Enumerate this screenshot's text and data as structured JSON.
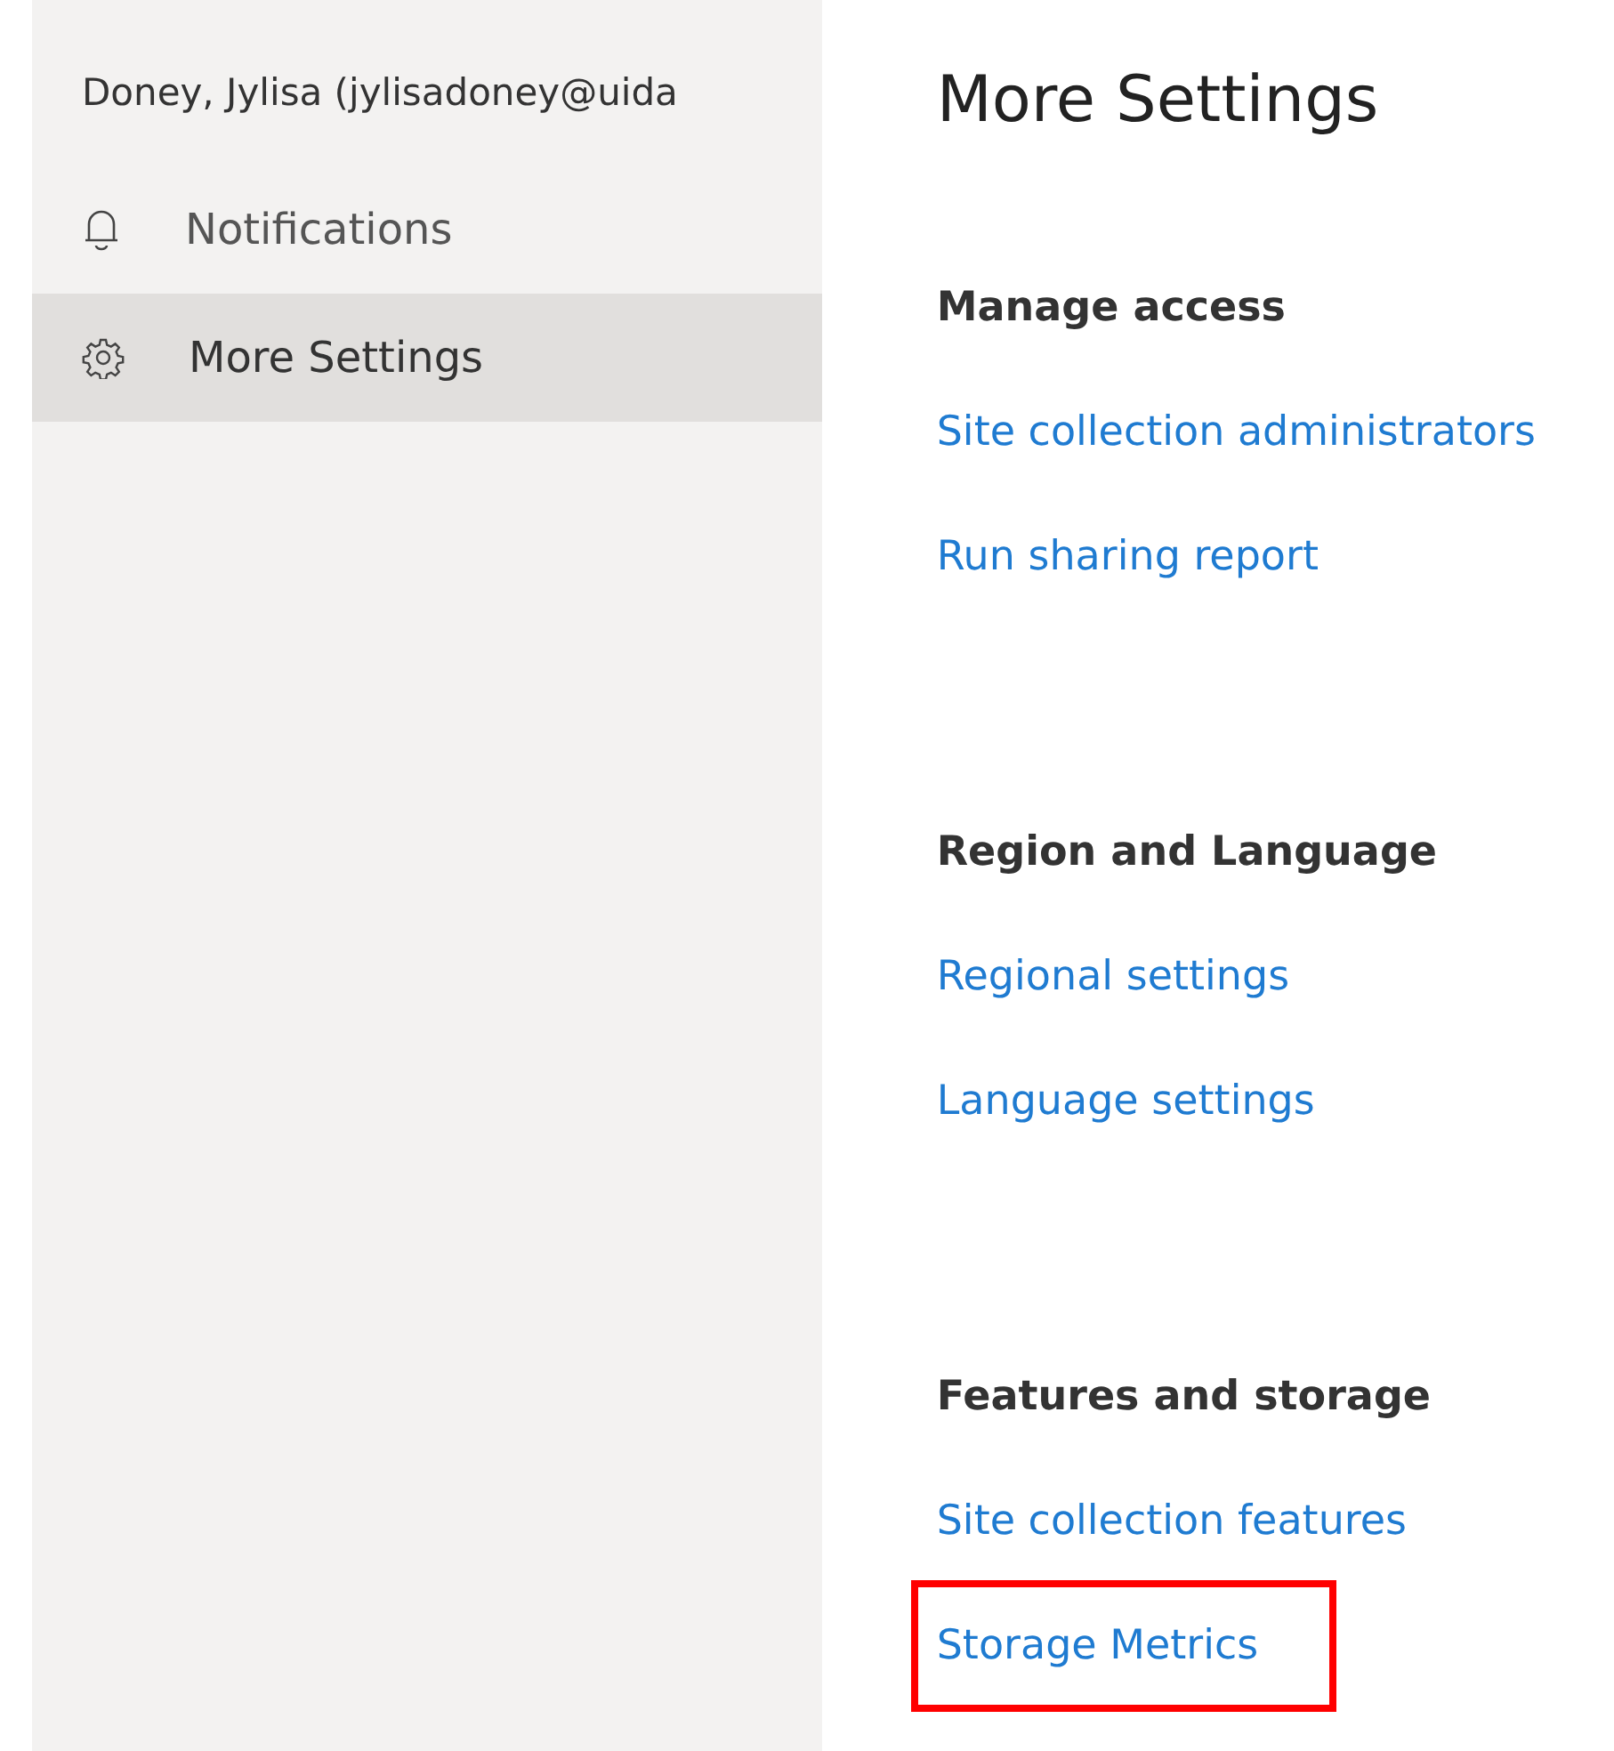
{
  "sidebar": {
    "account_name": "Doney, Jylisa (jylisadoney@uida",
    "items": [
      {
        "label": "Notifications",
        "kind": "bell",
        "selected": false
      },
      {
        "label": "More Settings",
        "kind": "gear",
        "selected": true
      }
    ]
  },
  "main": {
    "title": "More Settings",
    "sections": [
      {
        "heading": "Manage access",
        "links": [
          {
            "label": "Site collection administrators",
            "highlighted": false
          },
          {
            "label": "Run sharing report",
            "highlighted": false
          }
        ]
      },
      {
        "heading": "Region and Language",
        "links": [
          {
            "label": "Regional settings",
            "highlighted": false
          },
          {
            "label": "Language settings",
            "highlighted": false
          }
        ]
      },
      {
        "heading": "Features and storage",
        "links": [
          {
            "label": "Site collection features",
            "highlighted": false
          },
          {
            "label": "Storage Metrics",
            "highlighted": true
          }
        ]
      }
    ]
  }
}
